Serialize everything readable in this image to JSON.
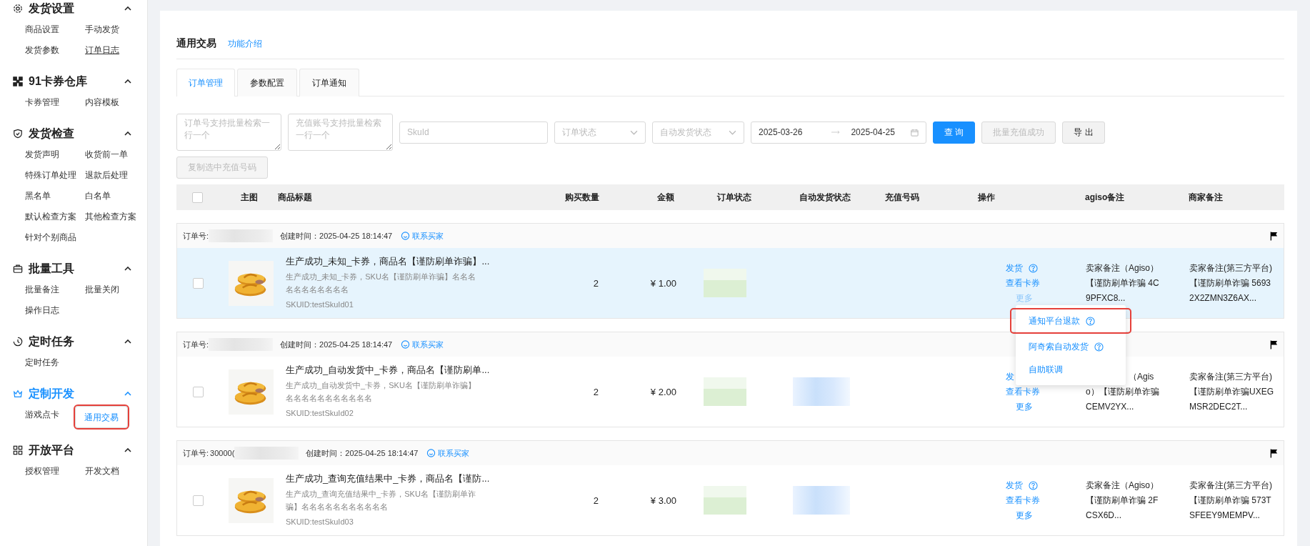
{
  "sidebar": {
    "sections": [
      {
        "title": "发货设置",
        "active": false,
        "expanded": true,
        "items": [
          {
            "label": "商品设置",
            "selected": false,
            "underlined": false,
            "highlighted": false
          },
          {
            "label": "手动发货",
            "selected": false,
            "underlined": false,
            "highlighted": false
          },
          {
            "label": "发货参数",
            "selected": false,
            "underlined": false,
            "highlighted": false
          },
          {
            "label": "订单日志",
            "selected": false,
            "underlined": true,
            "highlighted": false
          }
        ]
      },
      {
        "title": "91卡券仓库",
        "active": false,
        "expanded": true,
        "items": [
          {
            "label": "卡券管理",
            "selected": false,
            "underlined": false,
            "highlighted": false
          },
          {
            "label": "内容模板",
            "selected": false,
            "underlined": false,
            "highlighted": false
          }
        ]
      },
      {
        "title": "发货检查",
        "active": false,
        "expanded": true,
        "items": [
          {
            "label": "发货声明",
            "selected": false,
            "underlined": false,
            "highlighted": false
          },
          {
            "label": "收货前一单",
            "selected": false,
            "underlined": false,
            "highlighted": false
          },
          {
            "label": "特殊订单处理",
            "selected": false,
            "underlined": false,
            "highlighted": false
          },
          {
            "label": "退款后处理",
            "selected": false,
            "underlined": false,
            "highlighted": false
          },
          {
            "label": "黑名单",
            "selected": false,
            "underlined": false,
            "highlighted": false
          },
          {
            "label": "白名单",
            "selected": false,
            "underlined": false,
            "highlighted": false
          },
          {
            "label": "默认检查方案",
            "selected": false,
            "underlined": false,
            "highlighted": false
          },
          {
            "label": "其他检查方案",
            "selected": false,
            "underlined": false,
            "highlighted": false
          },
          {
            "label": "针对个别商品",
            "selected": false,
            "underlined": false,
            "highlighted": false
          }
        ]
      },
      {
        "title": "批量工具",
        "active": false,
        "expanded": true,
        "items": [
          {
            "label": "批量备注",
            "selected": false,
            "underlined": false,
            "highlighted": false
          },
          {
            "label": "批量关闭",
            "selected": false,
            "underlined": false,
            "highlighted": false
          },
          {
            "label": "操作日志",
            "selected": false,
            "underlined": false,
            "highlighted": false
          }
        ]
      },
      {
        "title": "定时任务",
        "active": false,
        "expanded": true,
        "items": [
          {
            "label": "定时任务",
            "selected": false,
            "underlined": false,
            "highlighted": false
          }
        ]
      },
      {
        "title": "定制开发",
        "active": true,
        "expanded": true,
        "items": [
          {
            "label": "游戏点卡",
            "selected": false,
            "underlined": false,
            "highlighted": false
          },
          {
            "label": "通用交易",
            "selected": true,
            "underlined": false,
            "highlighted": true
          }
        ]
      },
      {
        "title": "开放平台",
        "active": false,
        "expanded": true,
        "items": [
          {
            "label": "授权管理",
            "selected": false,
            "underlined": false,
            "highlighted": false
          },
          {
            "label": "开发文档",
            "selected": false,
            "underlined": false,
            "highlighted": false
          }
        ]
      }
    ]
  },
  "page": {
    "title": "通用交易",
    "help_link": "功能介绍"
  },
  "tabs": [
    {
      "label": "订单管理",
      "selected": true
    },
    {
      "label": "参数配置",
      "selected": false
    },
    {
      "label": "订单通知",
      "selected": false
    }
  ],
  "filters": {
    "order_no": {
      "placeholder": "订单号支持批量检索一行一个"
    },
    "account": {
      "placeholder": "充值账号支持批量检索一行一个"
    },
    "skuid": {
      "placeholder": "SkuId"
    },
    "order_status": {
      "placeholder": "订单状态"
    },
    "auto_status": {
      "placeholder": "自动发货状态"
    },
    "date_from": "2025-03-26",
    "date_to": "2025-04-25",
    "buttons": [
      {
        "label": "查 询",
        "kind": "primary",
        "disabled": false
      },
      {
        "label": "批量充值成功",
        "kind": "default",
        "disabled": true
      },
      {
        "label": "导 出",
        "kind": "default",
        "disabled": false
      }
    ],
    "copy_button": {
      "label": "复制选中充值号码",
      "disabled": true
    }
  },
  "table": {
    "select_all": {
      "checked": false
    },
    "columns": [
      "主图",
      "商品标题",
      "购买数量",
      "金额",
      "订单状态",
      "自动发货状态",
      "充值号码",
      "操作",
      "agiso备注",
      "商家备注"
    ],
    "orders": [
      {
        "order_label": "订单号:",
        "created": "创建时间：2025-04-25 18:14:47",
        "contact": "联系买家",
        "hovered": true,
        "checked": false,
        "status_redacted": true,
        "auto_status_redacted": false,
        "title": "生产成功_未知_卡券，商品名【谨防刷单诈骗】...",
        "sku": "生产成功_未知_卡券，SKU名【谨防刷单诈骗】名名名名名名名名名名名",
        "skuid": "SKUID:testSkuId01",
        "qty": "2",
        "amount": "¥ 1.00",
        "ship": "发货",
        "ship_help": true,
        "view": "查看卡券",
        "more": "更多",
        "menu_open": true,
        "agiso_note": "卖家备注（Agiso）【谨防刷单诈骗 4C9PFXC8...",
        "merchant_note": "卖家备注(第三方平台)【谨防刷单诈骗 56932X2ZMN3Z6AX..."
      },
      {
        "order_label": "订单号:",
        "created": "创建时间：2025-04-25 18:14:47",
        "contact": "联系买家",
        "hovered": false,
        "checked": false,
        "status_redacted": true,
        "auto_status_redacted": true,
        "title": "生产成功_自动发货中_卡券，商品名【谨防刷单...",
        "sku": "生产成功_自动发货中_卡券，SKU名【谨防刷单诈骗】名名名名名名名名名名名",
        "skuid": "SKUID:testSkuId02",
        "qty": "2",
        "amount": "¥ 2.00",
        "ship": "发",
        "ship_help": false,
        "view": "查看卡券",
        "more": "更多",
        "menu_open": false,
        "agiso_note": "（Agiso）【谨防刷单诈骗 CEMV2YX...",
        "merchant_note": "卖家备注(第三方平台)【谨防刷单诈骗UXEGMSR2DEC2T..."
      },
      {
        "order_label": "订单号:",
        "order_no": "30000(",
        "created": "创建时间：2025-04-25 18:14:47",
        "contact": "联系买家",
        "hovered": false,
        "checked": false,
        "status_redacted": true,
        "auto_status_redacted": true,
        "title": "生产成功_查询充值结果中_卡券，商品名【谨防...",
        "sku": "生产成功_查询充值结果中_卡券，SKU名【谨防刷单诈骗】名名名名名名名名名名名",
        "skuid": "SKUID:testSkuId03",
        "qty": "2",
        "amount": "¥ 3.00",
        "ship": "发货",
        "ship_help": true,
        "view": "查看卡券",
        "more": "更多",
        "menu_open": false,
        "agiso_note": "卖家备注（Agiso）【谨防刷单诈骗 2FCSX6D...",
        "merchant_note": "卖家备注(第三方平台)【谨防刷单诈骗 573TSFEEY9MEMPV..."
      }
    ],
    "more_menu": [
      {
        "label": "通知平台退款",
        "help": true,
        "highlighted": true
      },
      {
        "label": "阿奇索自动发货",
        "help": true,
        "highlighted": false
      },
      {
        "label": "自助联调",
        "help": false,
        "highlighted": false
      }
    ]
  }
}
